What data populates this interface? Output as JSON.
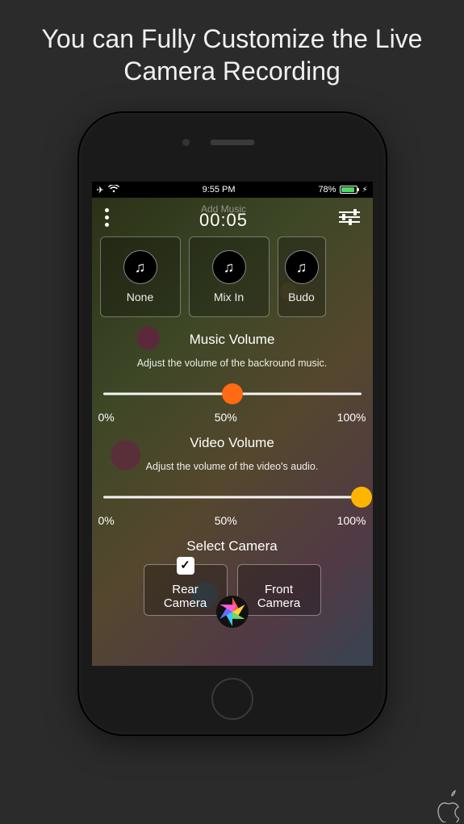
{
  "headline": "You can Fully Customize the Live Camera Recording",
  "status": {
    "time": "9:55 PM",
    "battery_pct": "78%"
  },
  "topbar": {
    "add_music_label": "Add Music",
    "timer": "00:05"
  },
  "music_options": [
    {
      "label": "None"
    },
    {
      "label": "Mix In"
    },
    {
      "label": "Budo"
    }
  ],
  "music_volume": {
    "title": "Music Volume",
    "subtitle": "Adjust the volume of the backround music.",
    "value_pct": 50,
    "ticks": [
      "0%",
      "50%",
      "100%"
    ]
  },
  "video_volume": {
    "title": "Video Volume",
    "subtitle": "Adjust the volume of the video's audio.",
    "value_pct": 100,
    "ticks": [
      "0%",
      "50%",
      "100%"
    ]
  },
  "camera": {
    "title": "Select Camera",
    "options": [
      {
        "label_line1": "Rear",
        "label_line2": "Camera",
        "selected": true
      },
      {
        "label_line1": "Front",
        "label_line2": "Camera",
        "selected": false
      }
    ]
  }
}
